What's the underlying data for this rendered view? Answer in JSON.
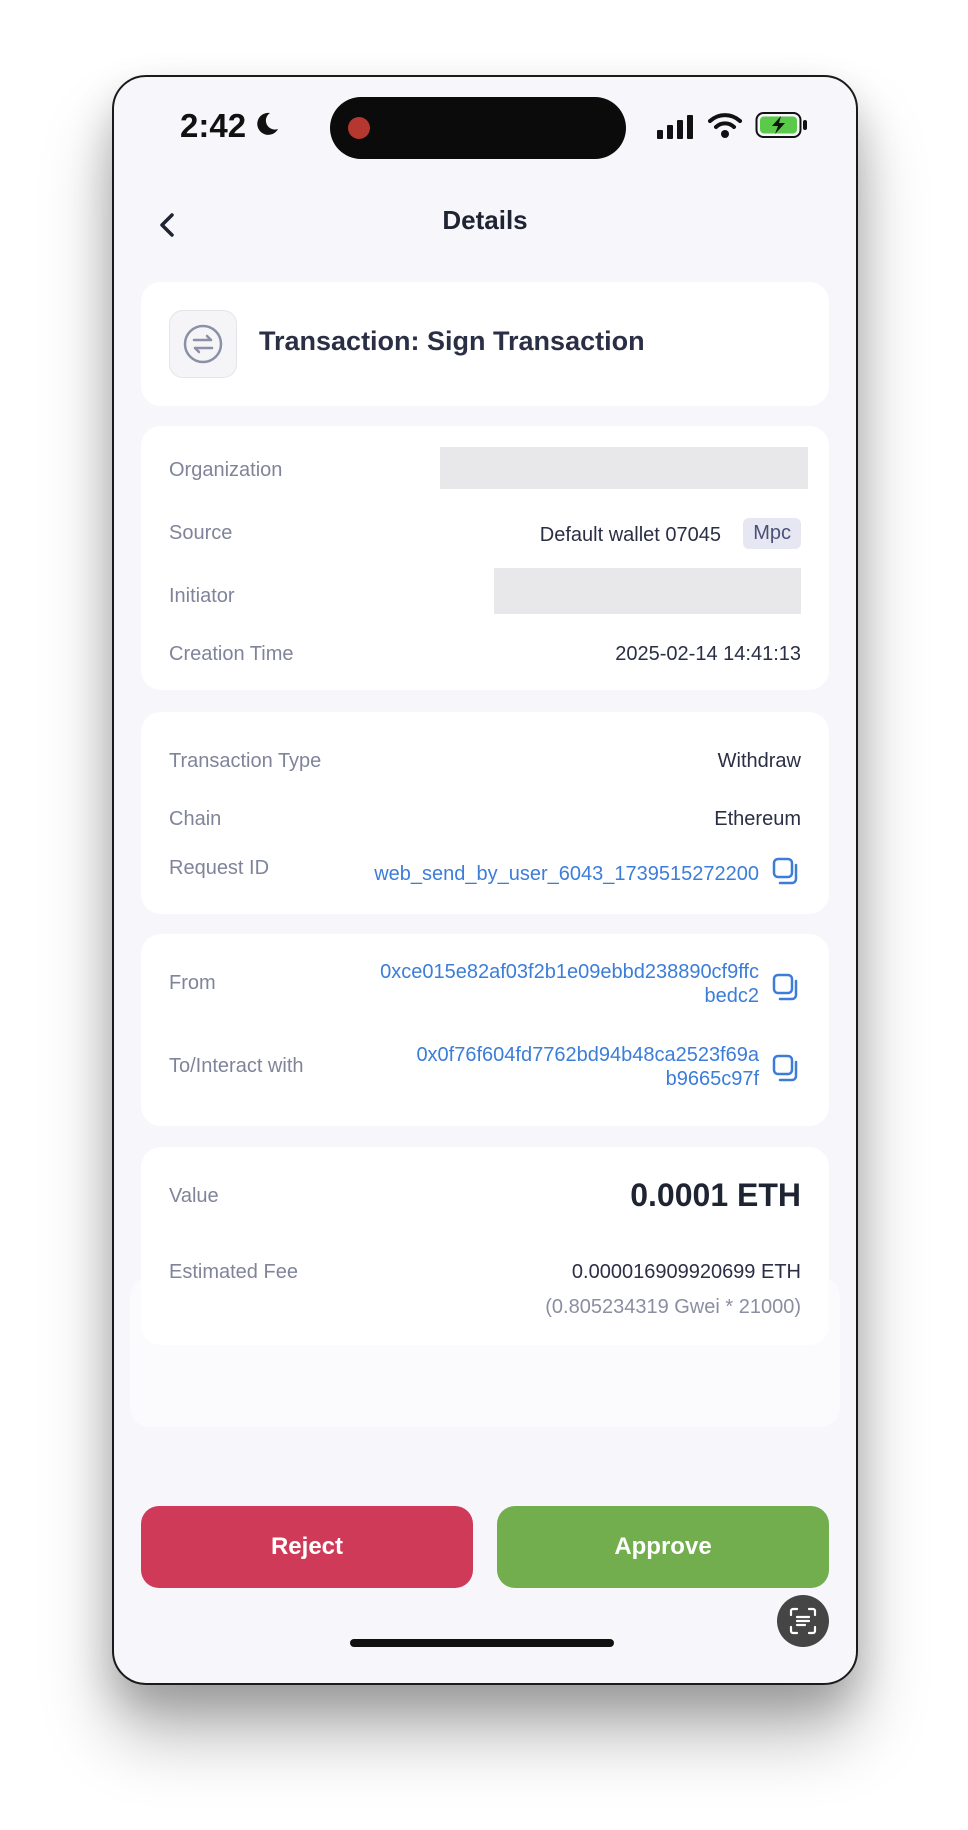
{
  "status_bar": {
    "time": "2:42"
  },
  "nav": {
    "title": "Details"
  },
  "header": {
    "title": "Transaction: Sign Transaction",
    "icon": "swap-arrows-icon"
  },
  "info": {
    "organization_label": "Organization",
    "source_label": "Source",
    "source_value": "Default wallet 07045",
    "source_tag": "Mpc",
    "initiator_label": "Initiator",
    "creation_time_label": "Creation Time",
    "creation_time_value": "2025-02-14 14:41:13"
  },
  "details": {
    "type_label": "Transaction Type",
    "type_value": "Withdraw",
    "chain_label": "Chain",
    "chain_value": "Ethereum",
    "request_id_label": "Request ID",
    "request_id_value": "web_send_by_user_6043_1739515272200"
  },
  "addresses": {
    "from_label": "From",
    "from_line1": "0xce015e82af03f2b1e09ebbd238890cf9ffc",
    "from_line2": "bedc2",
    "to_label": "To/Interact with",
    "to_line1": "0x0f76f604fd7762bd94b48ca2523f69a",
    "to_line2": "b9665c97f"
  },
  "amounts": {
    "value_label": "Value",
    "value": "0.0001 ETH",
    "fee_label": "Estimated Fee",
    "fee_value": "0.000016909920699 ETH",
    "fee_detail": "(0.805234319 Gwei * 21000)"
  },
  "actions": {
    "reject": "Reject",
    "approve": "Approve"
  },
  "colors": {
    "reject": "#cf3a58",
    "approve": "#72ad4e",
    "link": "#3b7dd8"
  }
}
